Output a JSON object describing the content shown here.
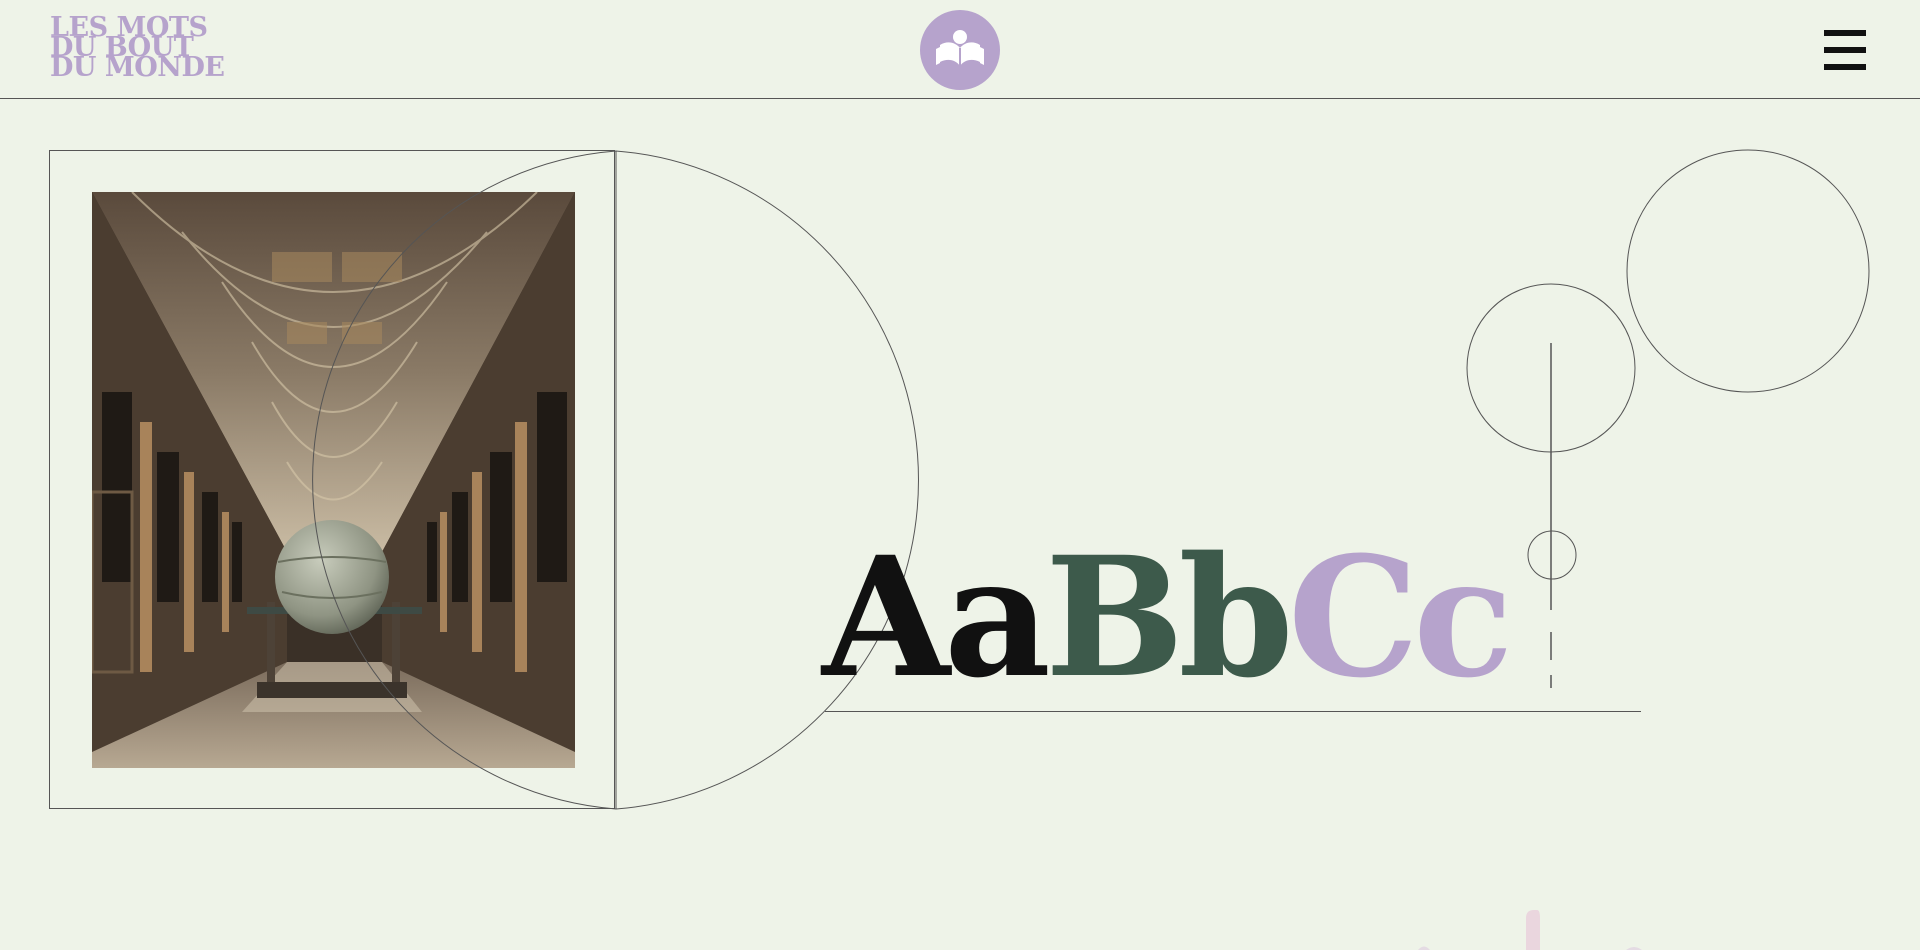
{
  "header": {
    "logo_lines": [
      "LES MOTS",
      "DU BOUT",
      "DU MONDE"
    ],
    "emblem_icon": "open-book-reader-icon",
    "menu_icon": "hamburger-menu-icon"
  },
  "hero": {
    "photo_subject": "library-hall-globe-image",
    "specimen": {
      "part1": "Aa",
      "part2": "Bb",
      "part3": "Cc"
    }
  },
  "colors": {
    "background": "#eef3e8",
    "accent_purple": "#b6a3cc",
    "accent_green": "#3d5a4b",
    "ink": "#111111",
    "line": "#555555"
  }
}
